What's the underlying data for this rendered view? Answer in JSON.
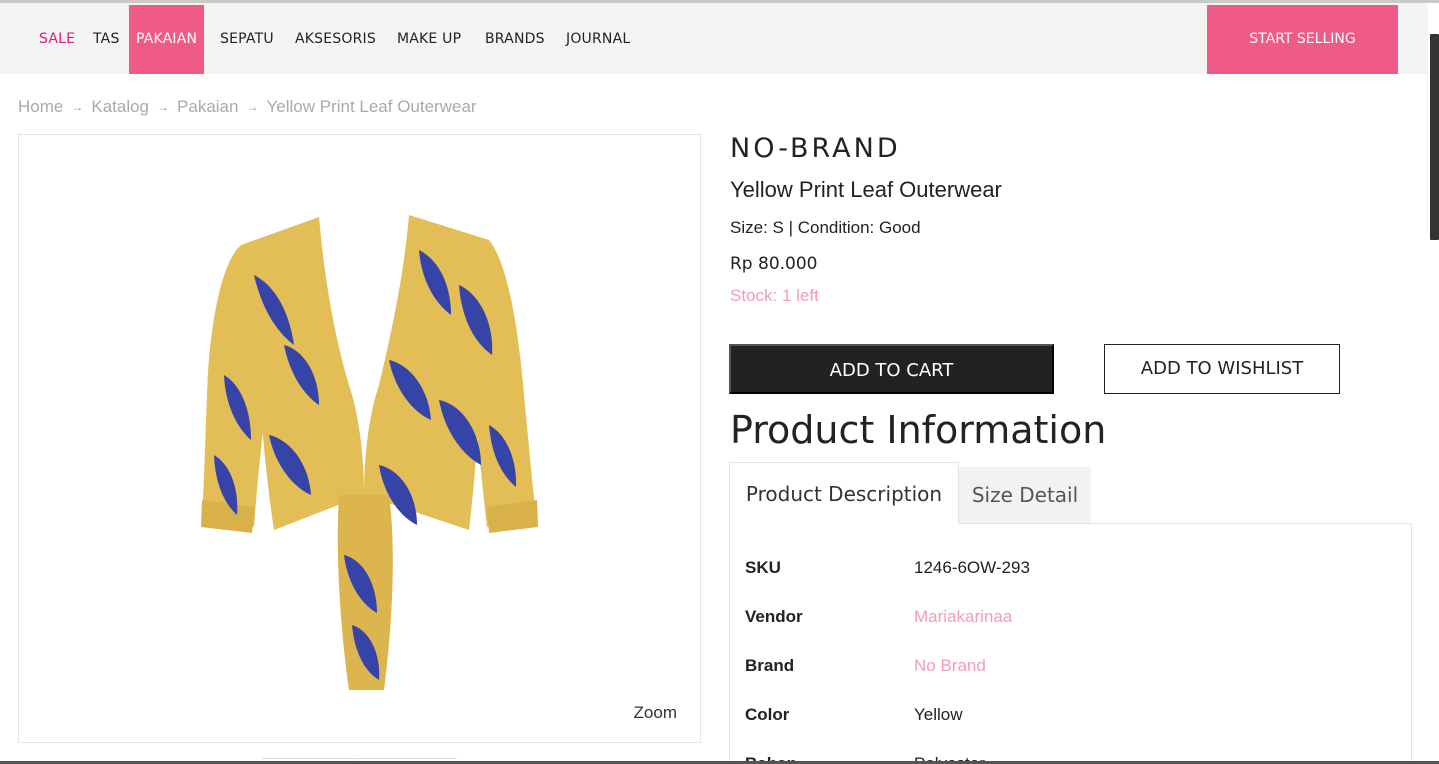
{
  "nav": {
    "items": [
      {
        "label": "SALE"
      },
      {
        "label": "TAS"
      },
      {
        "label": "PAKAIAN"
      },
      {
        "label": "SEPATU"
      },
      {
        "label": "AKSESORIS"
      },
      {
        "label": "MAKE UP"
      },
      {
        "label": "BRANDS"
      },
      {
        "label": "JOURNAL"
      }
    ],
    "cta_label": "START SELLING"
  },
  "breadcrumb": [
    "Home",
    "Katalog",
    "Pakaian",
    "Yellow Print Leaf Outerwear"
  ],
  "gallery": {
    "zoom_label": "Zoom"
  },
  "product": {
    "brand": "NO-BRAND",
    "title": "Yellow Print Leaf Outerwear",
    "size_condition": "Size: S | Condition: Good",
    "price": "Rp 80.000",
    "stock": "Stock: 1 left",
    "add_to_cart_label": "ADD TO CART",
    "add_to_wishlist_label": "ADD TO WISHLIST"
  },
  "info": {
    "section_title": "Product Information",
    "tabs": [
      {
        "label": "Product Description"
      },
      {
        "label": "Size Detail"
      }
    ],
    "rows": [
      {
        "label": "SKU",
        "value": "1246-6OW-293"
      },
      {
        "label": "Vendor",
        "value": "Mariakarinaa"
      },
      {
        "label": "Brand",
        "value": "No Brand"
      },
      {
        "label": "Color",
        "value": "Yellow"
      },
      {
        "label": "Bahan",
        "value": "Polyester"
      }
    ]
  },
  "colors": {
    "accent_pink": "#ef5a87",
    "sale_magenta": "#e0197f",
    "link_pink": "#f29bbd",
    "dark_button": "#222222",
    "garment_yellow": "#e3bd56",
    "leaf_blue": "#3644a8"
  }
}
